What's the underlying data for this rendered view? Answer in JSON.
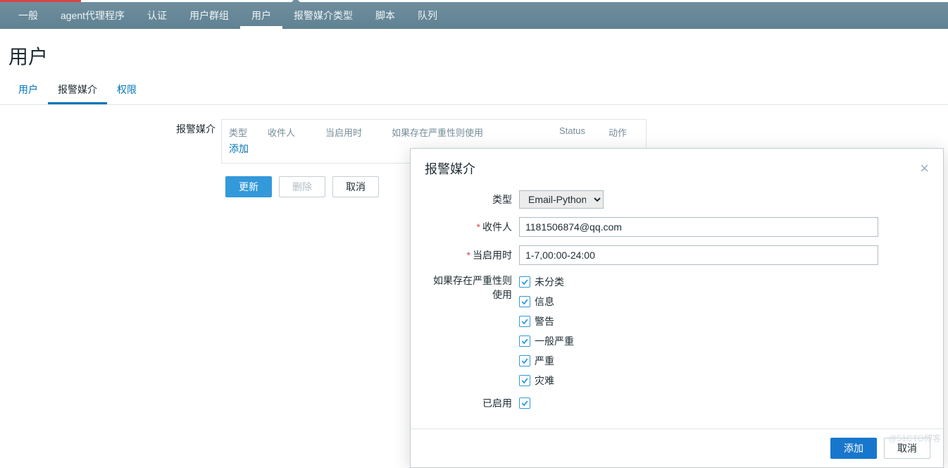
{
  "nav": {
    "items": [
      {
        "label": "一般"
      },
      {
        "label": "agent代理程序"
      },
      {
        "label": "认证"
      },
      {
        "label": "用户群组"
      },
      {
        "label": "用户",
        "active": true
      },
      {
        "label": "报警媒介类型"
      },
      {
        "label": "脚本"
      },
      {
        "label": "队列"
      }
    ]
  },
  "page": {
    "title": "用户"
  },
  "tabs": {
    "items": [
      {
        "label": "用户"
      },
      {
        "label": "报警媒介",
        "active": true
      },
      {
        "label": "权限"
      }
    ]
  },
  "media": {
    "section_label": "报警媒介",
    "columns": {
      "type": "类型",
      "recipient": "收件人",
      "when": "当启用时",
      "severity": "如果存在严重性则使用",
      "status": "Status",
      "action": "动作"
    },
    "add_link": "添加"
  },
  "buttons": {
    "update": "更新",
    "delete": "删除",
    "cancel": "取消"
  },
  "modal": {
    "title": "报警媒介",
    "fields": {
      "type_label": "类型",
      "type_value": "Email-Python",
      "recipient_label": "收件人",
      "recipient_value": "1181506874@qq.com",
      "when_label": "当启用时",
      "when_value": "1-7,00:00-24:00",
      "severity_label": "如果存在严重性则使用",
      "severities": [
        "未分类",
        "信息",
        "警告",
        "一般严重",
        "严重",
        "灾难"
      ],
      "enabled_label": "已启用"
    },
    "footer": {
      "add": "添加",
      "cancel": "取消"
    }
  },
  "watermark": "@51CTO博客"
}
